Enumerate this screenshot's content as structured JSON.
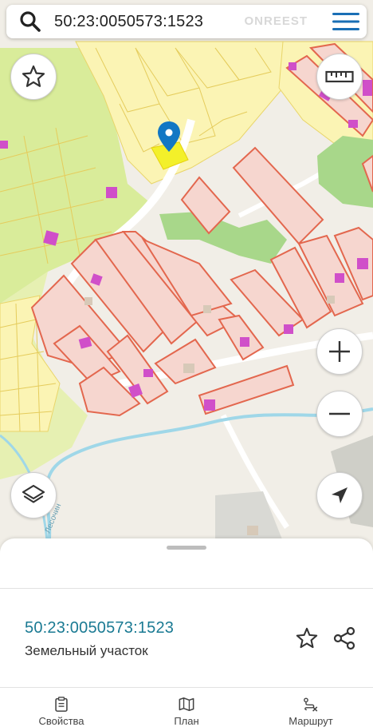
{
  "search": {
    "query": "50:23:0050573:1523",
    "watermark": "ONREEST"
  },
  "map": {
    "river_label": "Лесочин",
    "selected_parcel_color": "#f3f02a",
    "pin_color": "#1277c4",
    "parcel_fill": "#f6d6cf",
    "parcel_border": "#e3674e",
    "building_color": "#d04fc9",
    "forest_color": "#d9ec9a",
    "river_color": "#9fd7e8"
  },
  "controls": {
    "favorite": "star-icon",
    "ruler": "ruler-icon",
    "zoom_in": "plus-icon",
    "zoom_out": "minus-icon",
    "layers": "layers-icon",
    "locate": "navigation-arrow-icon"
  },
  "sheet": {
    "parcel_number": "50:23:0050573:1523",
    "parcel_type": "Земельный участок"
  },
  "tabbar": {
    "items": [
      {
        "label": "Свойства",
        "icon": "clipboard-icon"
      },
      {
        "label": "План",
        "icon": "map-icon"
      },
      {
        "label": "Маршрут",
        "icon": "route-icon"
      }
    ]
  }
}
